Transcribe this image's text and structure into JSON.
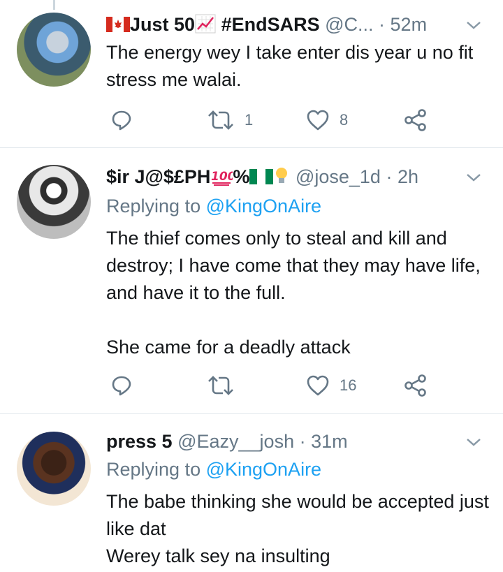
{
  "tweets": [
    {
      "name": "Just 50",
      "name_suffix": " #EndSARS",
      "handle": "@C...",
      "separator": " · ",
      "time": "52m",
      "reply_prefix": "",
      "reply_to": "",
      "text": "The energy wey I take enter dis year u no fit stress me walai.",
      "retweets": "1",
      "likes": "8"
    },
    {
      "name": "$ir J@$£PH",
      "name_suffix": "%",
      "handle": "@jose_1d",
      "separator": " · ",
      "time": "2h",
      "reply_prefix": "Replying to ",
      "reply_to": "@KingOnAire",
      "text": "The thief comes only to steal and kill and destroy; I have come that they may have life, and have it to the full.\n\nShe came for a deadly attack",
      "retweets": "",
      "likes": "16"
    },
    {
      "name": "press 5",
      "handle": "@Eazy__josh",
      "separator": " · ",
      "time": "31m",
      "reply_prefix": "Replying to ",
      "reply_to": "@KingOnAire",
      "text": "The babe thinking she would be accepted just like dat\nWerey talk sey na insulting"
    }
  ],
  "icons": {
    "reply": "reply-icon",
    "retweet": "retweet-icon",
    "like": "heart-icon",
    "share": "share-icon",
    "more": "chevron-down-icon"
  },
  "colors": {
    "text": "#14171a",
    "secondary": "#657786",
    "link": "#1da1f2",
    "divider": "#e1e8ed"
  }
}
